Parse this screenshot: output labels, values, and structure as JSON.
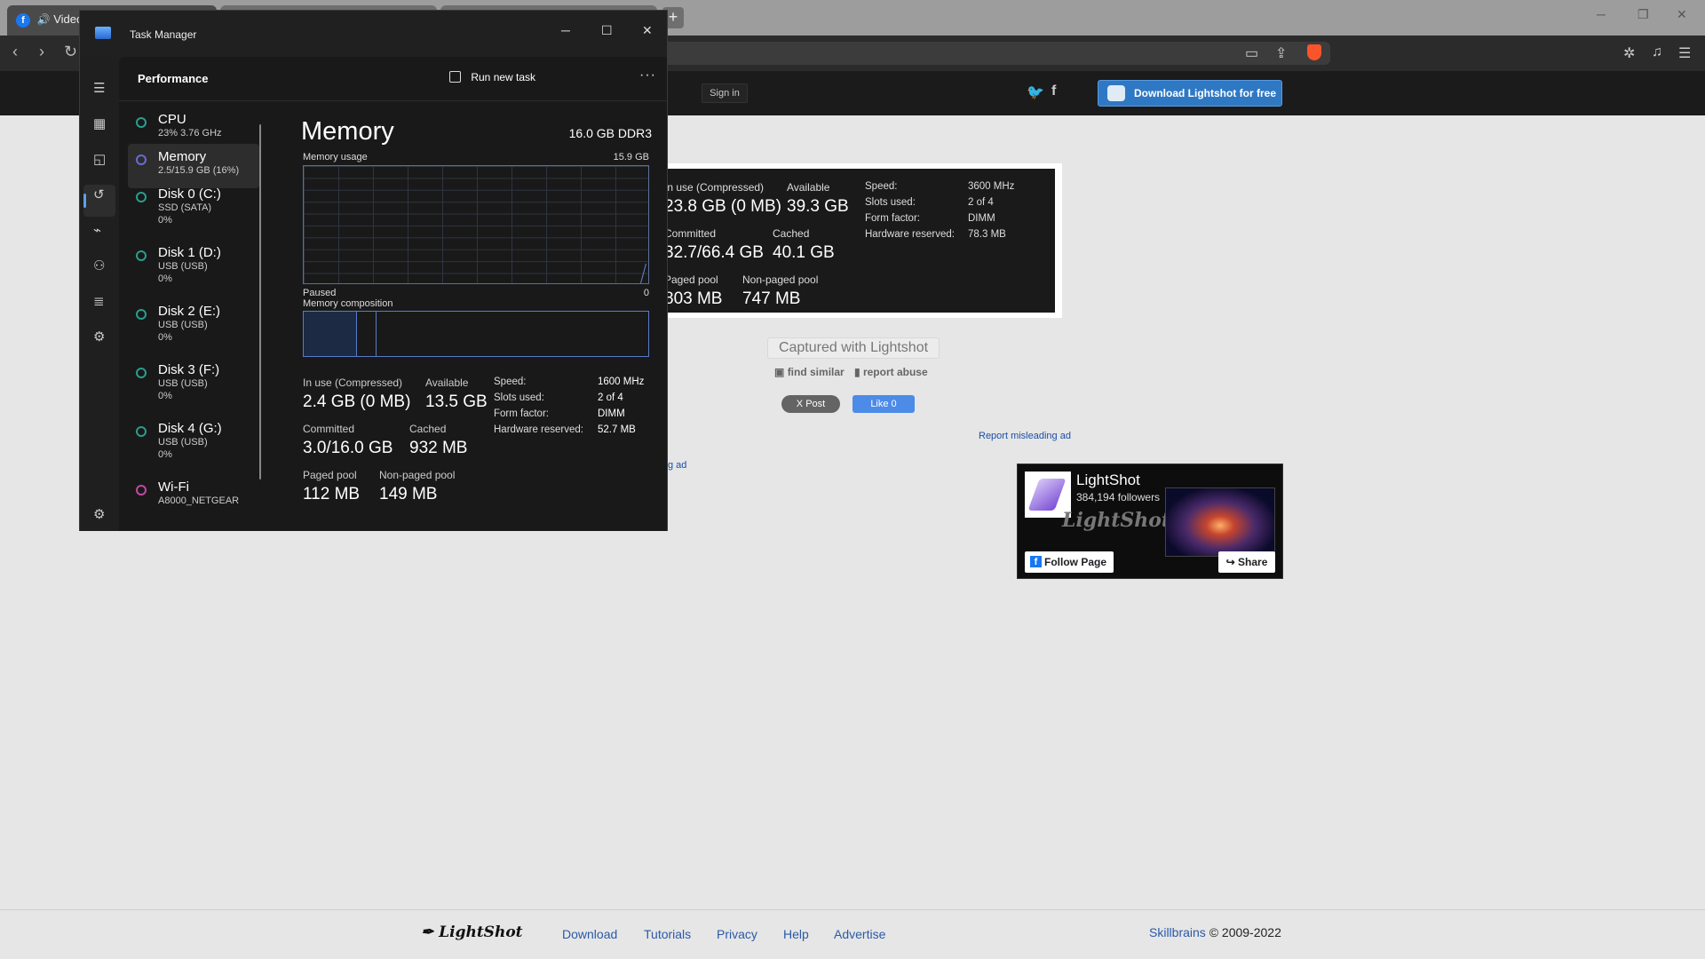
{
  "browser": {
    "tab1_label": "Video",
    "new_tab": "+"
  },
  "lightshot": {
    "signin": "Sign in",
    "download_button": "Download Lightshot for free",
    "screenshot": {
      "in_use_label": "In use (Compressed)",
      "in_use_value": "23.8 GB (0 MB)",
      "available_label": "Available",
      "available_value": "39.3 GB",
      "committed_label": "Committed",
      "committed_value": "32.7/66.4 GB",
      "cached_label": "Cached",
      "cached_value": "40.1 GB",
      "paged_label": "Paged pool",
      "paged_value": "803 MB",
      "nonpaged_label": "Non-paged pool",
      "nonpaged_value": "747 MB",
      "speed_label": "Speed:",
      "speed_value": "3600 MHz",
      "slots_label": "Slots used:",
      "slots_value": "2 of 4",
      "form_label": "Form factor:",
      "form_value": "DIMM",
      "hw_label": "Hardware reserved:",
      "hw_value": "78.3 MB"
    },
    "captured": "Captured with Lightshot",
    "find_similar": "find similar",
    "report_abuse": "report abuse",
    "x_post": "X Post",
    "fb_like": "Like 0",
    "report_ad": "Report misleading ad",
    "g_ad": "g ad",
    "fb": {
      "name": "LightShot",
      "followers": "384,194 followers",
      "wordmark": "LightShot",
      "follow": "Follow Page",
      "share": "Share"
    },
    "footer": {
      "logo": "LightShot",
      "links": [
        "Download",
        "Tutorials",
        "Privacy",
        "Help",
        "Advertise"
      ],
      "brand": "Skillbrains",
      "copy": "© 2009-2022"
    }
  },
  "task_manager": {
    "title": "Task Manager",
    "page": "Performance",
    "run_new_task": "Run new task",
    "devices": [
      {
        "name": "CPU",
        "sub1": "23%  3.76 GHz",
        "sub2": "",
        "sub3": ""
      },
      {
        "name": "Memory",
        "sub1": "2.5/15.9 GB (16%)",
        "sub2": "",
        "sub3": ""
      },
      {
        "name": "Disk 0 (C:)",
        "sub1": "SSD (SATA)",
        "sub2": "0%",
        "sub3": ""
      },
      {
        "name": "Disk 1 (D:)",
        "sub1": "USB (USB)",
        "sub2": "0%",
        "sub3": ""
      },
      {
        "name": "Disk 2 (E:)",
        "sub1": "USB (USB)",
        "sub2": "0%",
        "sub3": ""
      },
      {
        "name": "Disk 3 (F:)",
        "sub1": "USB (USB)",
        "sub2": "0%",
        "sub3": ""
      },
      {
        "name": "Disk 4 (G:)",
        "sub1": "USB (USB)",
        "sub2": "0%",
        "sub3": ""
      },
      {
        "name": "Wi-Fi",
        "sub1": "A8000_NETGEAR",
        "sub2": "",
        "sub3": ""
      }
    ],
    "memory": {
      "title": "Memory",
      "spec": "16.0 GB DDR3",
      "usage_label": "Memory usage",
      "usage_max": "15.9 GB",
      "paused": "Paused",
      "zero": "0",
      "composition_label": "Memory composition",
      "in_use_label": "In use (Compressed)",
      "in_use_value": "2.4 GB (0 MB)",
      "available_label": "Available",
      "available_value": "13.5 GB",
      "committed_label": "Committed",
      "committed_value": "3.0/16.0 GB",
      "cached_label": "Cached",
      "cached_value": "932 MB",
      "paged_label": "Paged pool",
      "paged_value": "112 MB",
      "nonpaged_label": "Non-paged pool",
      "nonpaged_value": "149 MB",
      "speed_label": "Speed:",
      "speed_value": "1600 MHz",
      "slots_label": "Slots used:",
      "slots_value": "2 of 4",
      "form_label": "Form factor:",
      "form_value": "DIMM",
      "hw_label": "Hardware reserved:",
      "hw_value": "52.7 MB"
    },
    "colors": {
      "cpu": "#2a9d8f",
      "memory": "#6a6ad6",
      "disk": "#2a9d8f",
      "wifi": "#c04aa0"
    }
  }
}
